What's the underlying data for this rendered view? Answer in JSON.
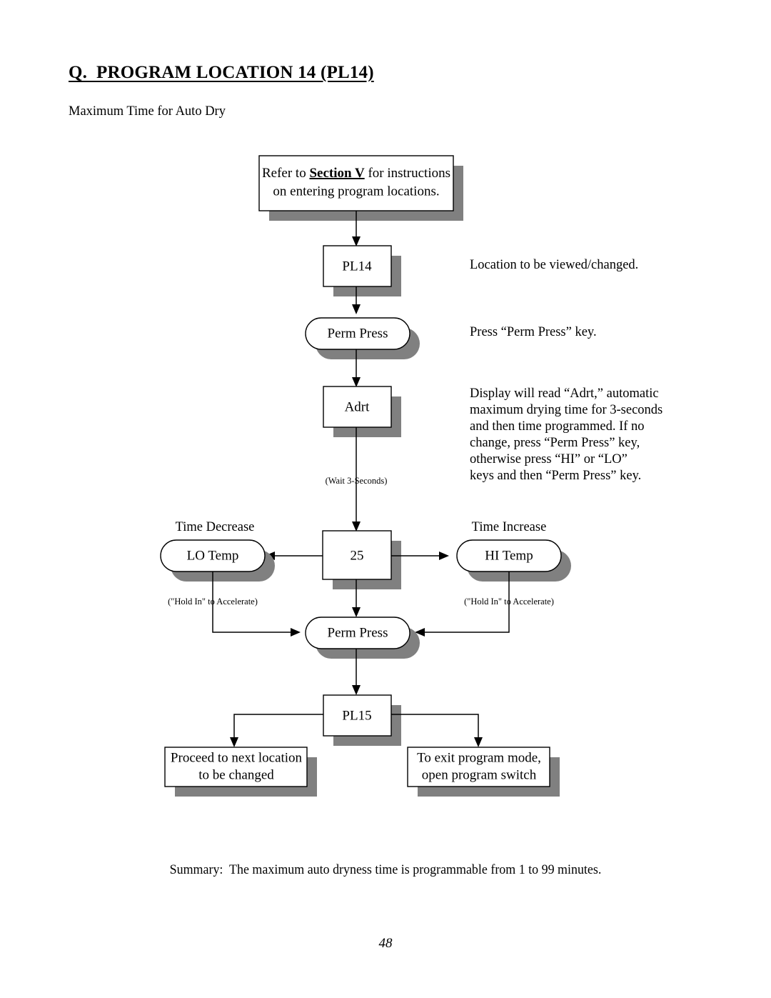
{
  "document": {
    "title": "Q.  PROGRAM LOCATION 14 (PL14)",
    "subtitle": "Maximum Time for Auto Dry",
    "summary": "Summary:  The maximum auto dryness time is programmable from 1 to 99 minutes.",
    "page_number": "48"
  },
  "flowchart": {
    "intro_box": {
      "line1_prefix": "Refer to ",
      "line1_emphasis": "Section V",
      "line1_suffix": " for instructions",
      "line2": "on entering program locations."
    },
    "nodes": {
      "pl14": "PL14",
      "perm_press_1": "Perm Press",
      "adrt": "Adrt",
      "value": "25",
      "lo_temp": "LO Temp",
      "hi_temp": "HI Temp",
      "perm_press_2": "Perm Press",
      "pl15": "PL15"
    },
    "labels": {
      "wait": "(Wait 3-Seconds)",
      "time_decrease": "Time  Decrease",
      "time_increase": "Time  Increase",
      "hold_in_left": "(\"Hold In\" to Accelerate)",
      "hold_in_right": "(\"Hold In\" to Accelerate)"
    },
    "terminal_boxes": {
      "proceed_line1": "Proceed to next location",
      "proceed_line2": "to be changed",
      "exit_line1": "To exit program mode,",
      "exit_line2": "open program switch"
    },
    "annotations": {
      "pl14_note": "Location to be viewed/changed.",
      "perm_press_note": "Press “Perm  Press”  key.",
      "adrt_note": [
        "Display will read “Adrt,” automatic",
        "maximum drying time for 3-seconds",
        "and then time programmed.  If no",
        "change, press “Perm Press” key,",
        "otherwise press “HI” or “LO”",
        "keys and then “Perm Press” key."
      ]
    },
    "colors": {
      "shadow": "#808080",
      "line": "#000000",
      "fill": "#ffffff"
    }
  }
}
